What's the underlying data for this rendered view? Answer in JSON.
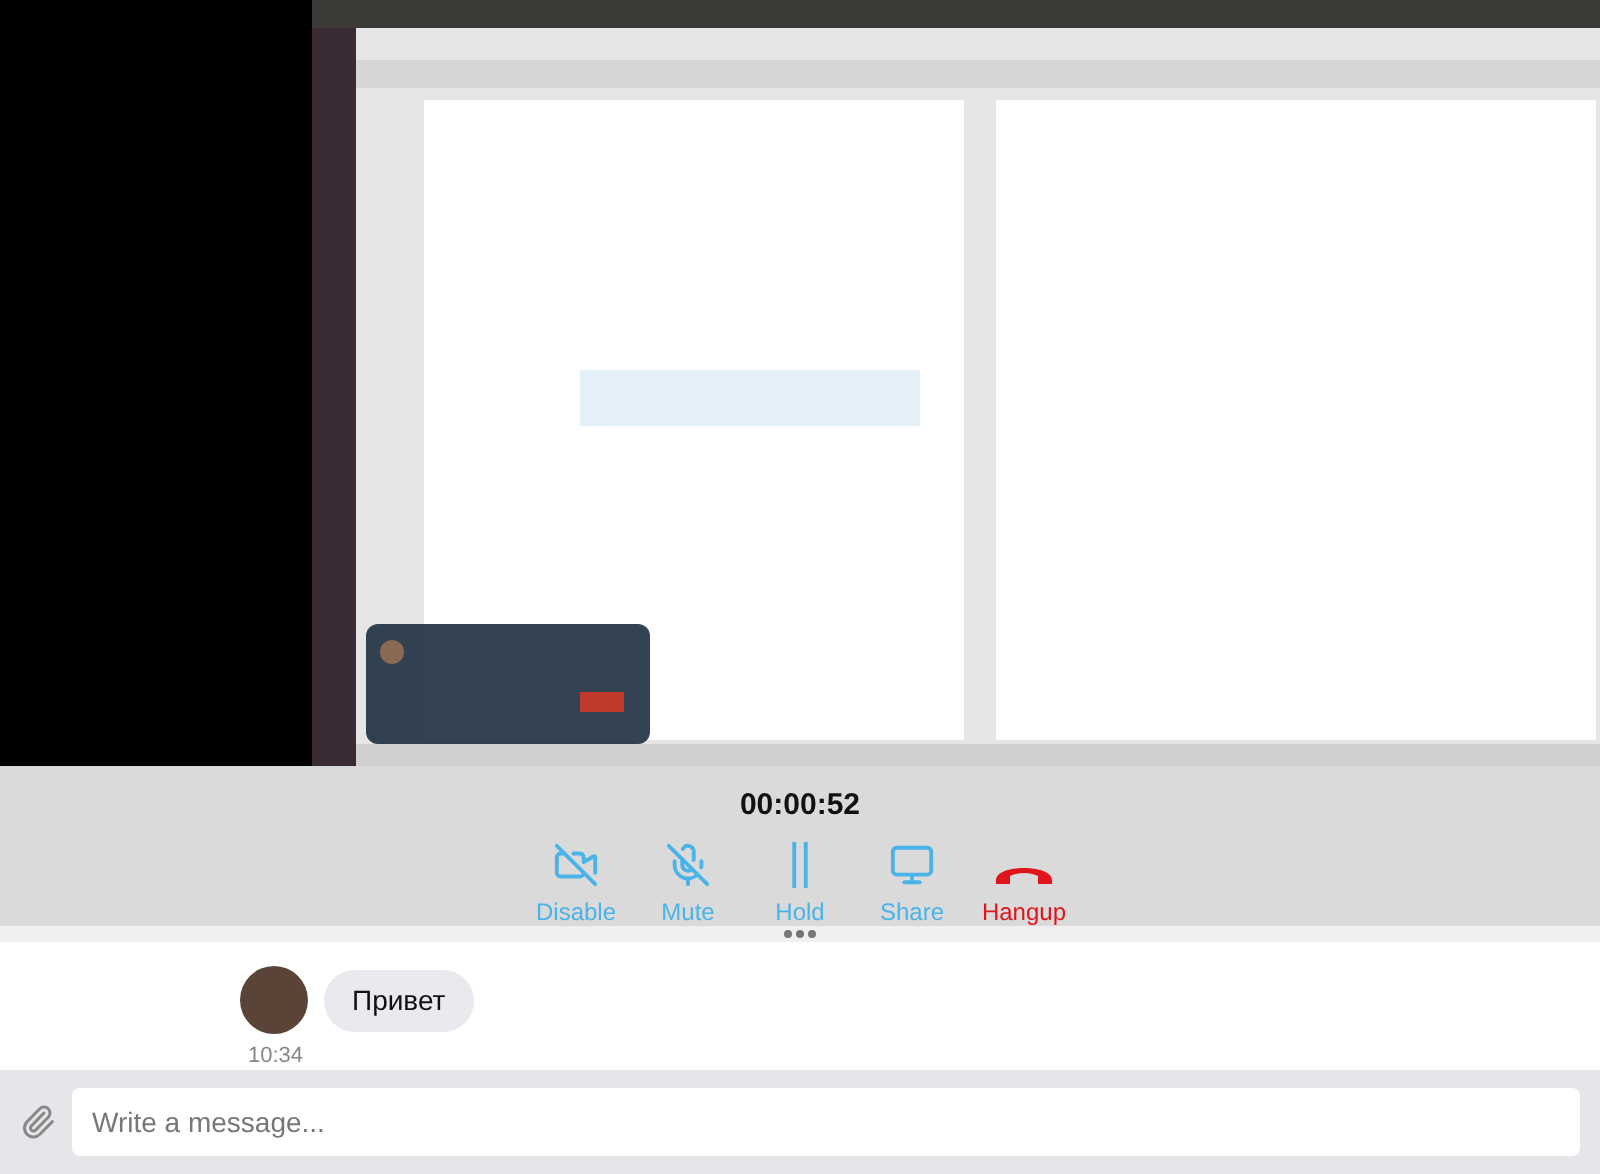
{
  "call": {
    "timer": "00:00:52",
    "controls": [
      {
        "kind": "camera",
        "label": "Disable"
      },
      {
        "kind": "mic",
        "label": "Mute"
      },
      {
        "kind": "hold",
        "label": "Hold"
      },
      {
        "kind": "share",
        "label": "Share"
      },
      {
        "kind": "hangup",
        "label": "Hangup"
      }
    ]
  },
  "messages": [
    {
      "text": "Привет",
      "time": "10:34"
    }
  ],
  "composer": {
    "placeholder": "Write a message..."
  }
}
